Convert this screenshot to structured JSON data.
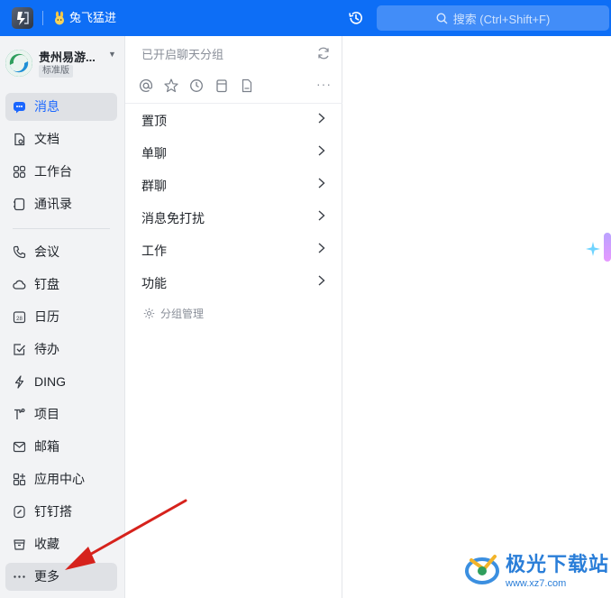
{
  "topbar": {
    "workspace_name": "兔飞猛进",
    "search_placeholder": "搜索 (Ctrl+Shift+F)",
    "accent_color": "#0d6ef6",
    "icons": [
      "app-logo-icon",
      "rabbit-icon",
      "history-icon",
      "search-icon"
    ]
  },
  "org": {
    "name": "贵州易游...",
    "badge": "标准版"
  },
  "sidebar": {
    "active_color": "#1a66ff",
    "items": [
      {
        "label": "消息",
        "icon": "message-icon",
        "active": true
      },
      {
        "label": "文档",
        "icon": "document-icon"
      },
      {
        "label": "工作台",
        "icon": "workbench-icon"
      },
      {
        "label": "通讯录",
        "icon": "contacts-icon"
      },
      {
        "label": "会议",
        "icon": "phone-icon"
      },
      {
        "label": "钉盘",
        "icon": "cloud-icon"
      },
      {
        "label": "日历",
        "icon": "calendar-icon"
      },
      {
        "label": "待办",
        "icon": "todo-icon"
      },
      {
        "label": "DING",
        "icon": "lightning-icon"
      },
      {
        "label": "项目",
        "icon": "project-icon"
      },
      {
        "label": "邮箱",
        "icon": "mail-icon"
      },
      {
        "label": "应用中心",
        "icon": "app-center-icon"
      },
      {
        "label": "钉钉搭",
        "icon": "builder-icon"
      },
      {
        "label": "收藏",
        "icon": "favorites-icon"
      },
      {
        "label": "更多",
        "icon": "more-icon"
      }
    ]
  },
  "panel": {
    "title": "已开启聊天分组",
    "filter_icons": [
      "at-icon",
      "star-icon",
      "clock-icon",
      "trash-icon",
      "file-icon"
    ],
    "groups": [
      "置顶",
      "单聊",
      "群聊",
      "消息免打扰",
      "工作",
      "功能"
    ],
    "manage_label": "分组管理"
  },
  "watermark": {
    "text": "极光下载站",
    "url": "www.xz7.com"
  }
}
